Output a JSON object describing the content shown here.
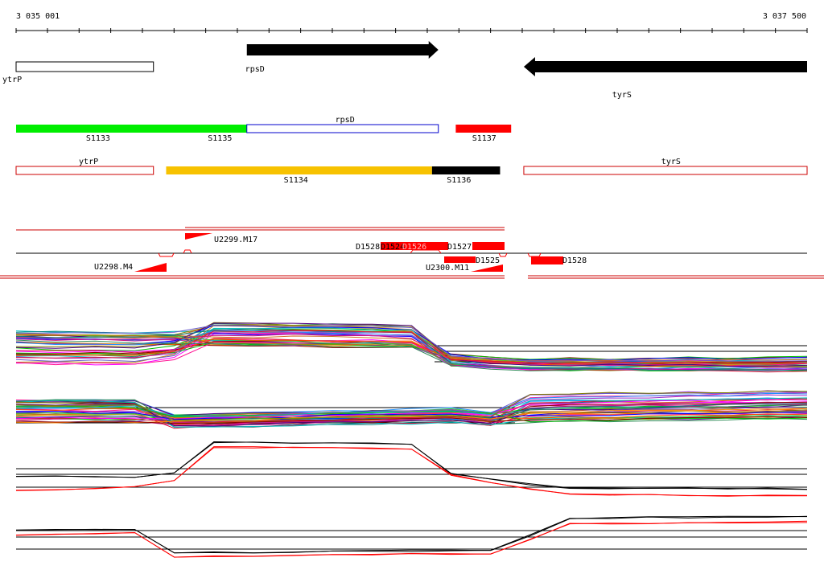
{
  "ruler": {
    "start_label": "3 035 001",
    "end_label": "3 037 500",
    "start_bp": 3035001,
    "end_bp": 3037500,
    "tick_step_bp": 100
  },
  "annotation": {
    "genes": [
      {
        "name": "ytrP",
        "start": 3035001,
        "end": 3035435,
        "strand": "none",
        "style": "outline",
        "label_bp": 3035230
      },
      {
        "name": "rpsD",
        "start": 3035730,
        "end": 3036335,
        "strand": "+",
        "style": "filled",
        "label_bp": 3036035
      },
      {
        "name": "tyrS",
        "start": 3036605,
        "end": 3037500,
        "strand": "-",
        "style": "filled",
        "label_bp": 3037070
      }
    ]
  },
  "segments": {
    "row1": [
      {
        "label": "S1133",
        "start": 3035001,
        "end": 3035730,
        "color": "#00ee00",
        "style": "filled",
        "label_bp": 3035260
      },
      {
        "label": "S1135",
        "start": 3035650,
        "end": 3035730,
        "color": "#00ee00",
        "style": "filled",
        "label_bp": 3035645
      },
      {
        "label": "rpsD",
        "start": 3035730,
        "end": 3036335,
        "color": "#0000cc",
        "style": "outline",
        "label_bp": 3036040,
        "label_above": true
      },
      {
        "label": "S1137",
        "start": 3036390,
        "end": 3036565,
        "color": "#ff0000",
        "style": "filled",
        "label_bp": 3036480
      }
    ],
    "row2": [
      {
        "label": "ytrP",
        "start": 3035001,
        "end": 3035435,
        "color": "#cc0000",
        "style": "outline",
        "label_bp": 3035230,
        "label_above": true
      },
      {
        "label": "S1134",
        "start": 3035475,
        "end": 3036315,
        "color": "#f7c200",
        "style": "filled",
        "label_bp": 3035885
      },
      {
        "label": "S1136",
        "start": 3036315,
        "end": 3036530,
        "color": "#000000",
        "style": "filled",
        "label_bp": 3036400
      },
      {
        "label": "tyrS",
        "start": 3036605,
        "end": 3037500,
        "color": "#cc0000",
        "style": "outline",
        "label_bp": 3037070,
        "label_above": true
      }
    ]
  },
  "features": {
    "colors": {
      "feature": "#ff0000",
      "line": "#000000",
      "guide": "#cc0000"
    },
    "labels": [
      {
        "text": "U2299.M17",
        "bp": 3035640
      },
      {
        "text": "D1528",
        "bp": 3036035
      },
      {
        "text": "D1524",
        "bp": 3036110
      },
      {
        "text": "D1526",
        "bp": 3036180
      },
      {
        "text": "D1527",
        "bp": 3036335
      },
      {
        "text": "U2298.M4",
        "bp": 3035245
      },
      {
        "text": "U2300.M11",
        "bp": 3036285
      },
      {
        "text": "D1525",
        "bp": 3036440
      },
      {
        "text": "D1528",
        "bp": 3036705
      }
    ]
  },
  "chart_data": [
    {
      "type": "line",
      "panel": 1,
      "description_series_count": 40,
      "x_range": [
        3035001,
        3037500
      ]
    },
    {
      "type": "line",
      "panel": 2,
      "description_series_count": 40,
      "x_range": [
        3035001,
        3037500
      ]
    },
    {
      "type": "line",
      "panel": 3,
      "series_colors": [
        "#000000",
        "#ff0000"
      ],
      "x_range": [
        3035001,
        3037500
      ]
    },
    {
      "type": "line",
      "panel": 4,
      "series_colors": [
        "#000000",
        "#ff0000"
      ],
      "x_range": [
        3035001,
        3037500
      ]
    }
  ]
}
